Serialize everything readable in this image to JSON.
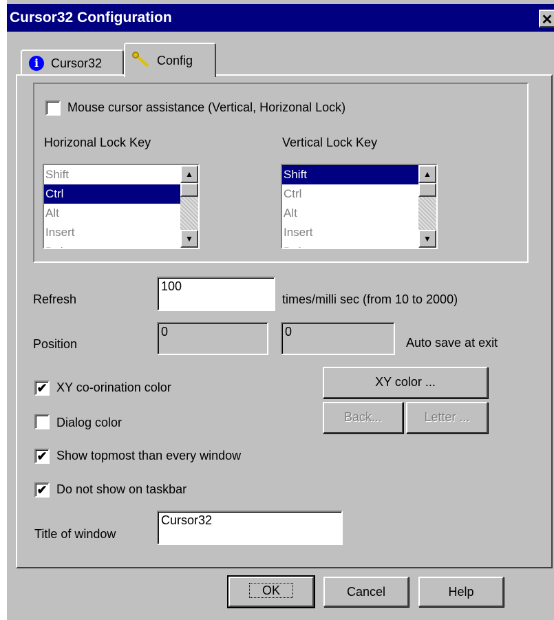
{
  "window": {
    "title": "Cursor32 Configuration",
    "close_glyph": "✕"
  },
  "tabs": [
    {
      "label": "Cursor32",
      "icon": "info-icon",
      "active": false
    },
    {
      "label": "Config",
      "icon": "wrench-icon",
      "active": true
    }
  ],
  "assist": {
    "checkbox_label": "Mouse cursor assistance (Vertical, Horizonal Lock)",
    "checked": false,
    "horizontal_label": "Horizonal Lock Key",
    "vertical_label": "Vertical Lock Key",
    "horizontal_items": [
      "Shift",
      "Ctrl",
      "Alt",
      "Insert",
      "Delete"
    ],
    "horizontal_selected": "Ctrl",
    "vertical_items": [
      "Shift",
      "Ctrl",
      "Alt",
      "Insert",
      "Delete"
    ],
    "vertical_selected": "Shift"
  },
  "refresh": {
    "label": "Refresh",
    "value": "100",
    "unit": "times/milli sec  (from 10 to 2000)"
  },
  "position": {
    "label": "Position",
    "x": "0",
    "y": "0",
    "note": "Auto save at exit"
  },
  "options": {
    "xy_color": {
      "label": "XY co-orination color",
      "checked": true
    },
    "dialog_color": {
      "label": "Dialog color",
      "checked": false
    },
    "topmost": {
      "label": "Show topmost than every window",
      "checked": true
    },
    "no_taskbar": {
      "label": "Do not show on taskbar",
      "checked": true
    }
  },
  "color_buttons": {
    "xy": "XY color ...",
    "back": "Back...",
    "letter": "Letter ..."
  },
  "title_of_window": {
    "label": "Title of window",
    "value": "Cursor32"
  },
  "footer": {
    "ok": "OK",
    "cancel": "Cancel",
    "help": "Help"
  },
  "check_glyph": "✔",
  "colors": {
    "titlebar": "#000080",
    "face": "#c0c0c0",
    "selection": "#000080"
  }
}
